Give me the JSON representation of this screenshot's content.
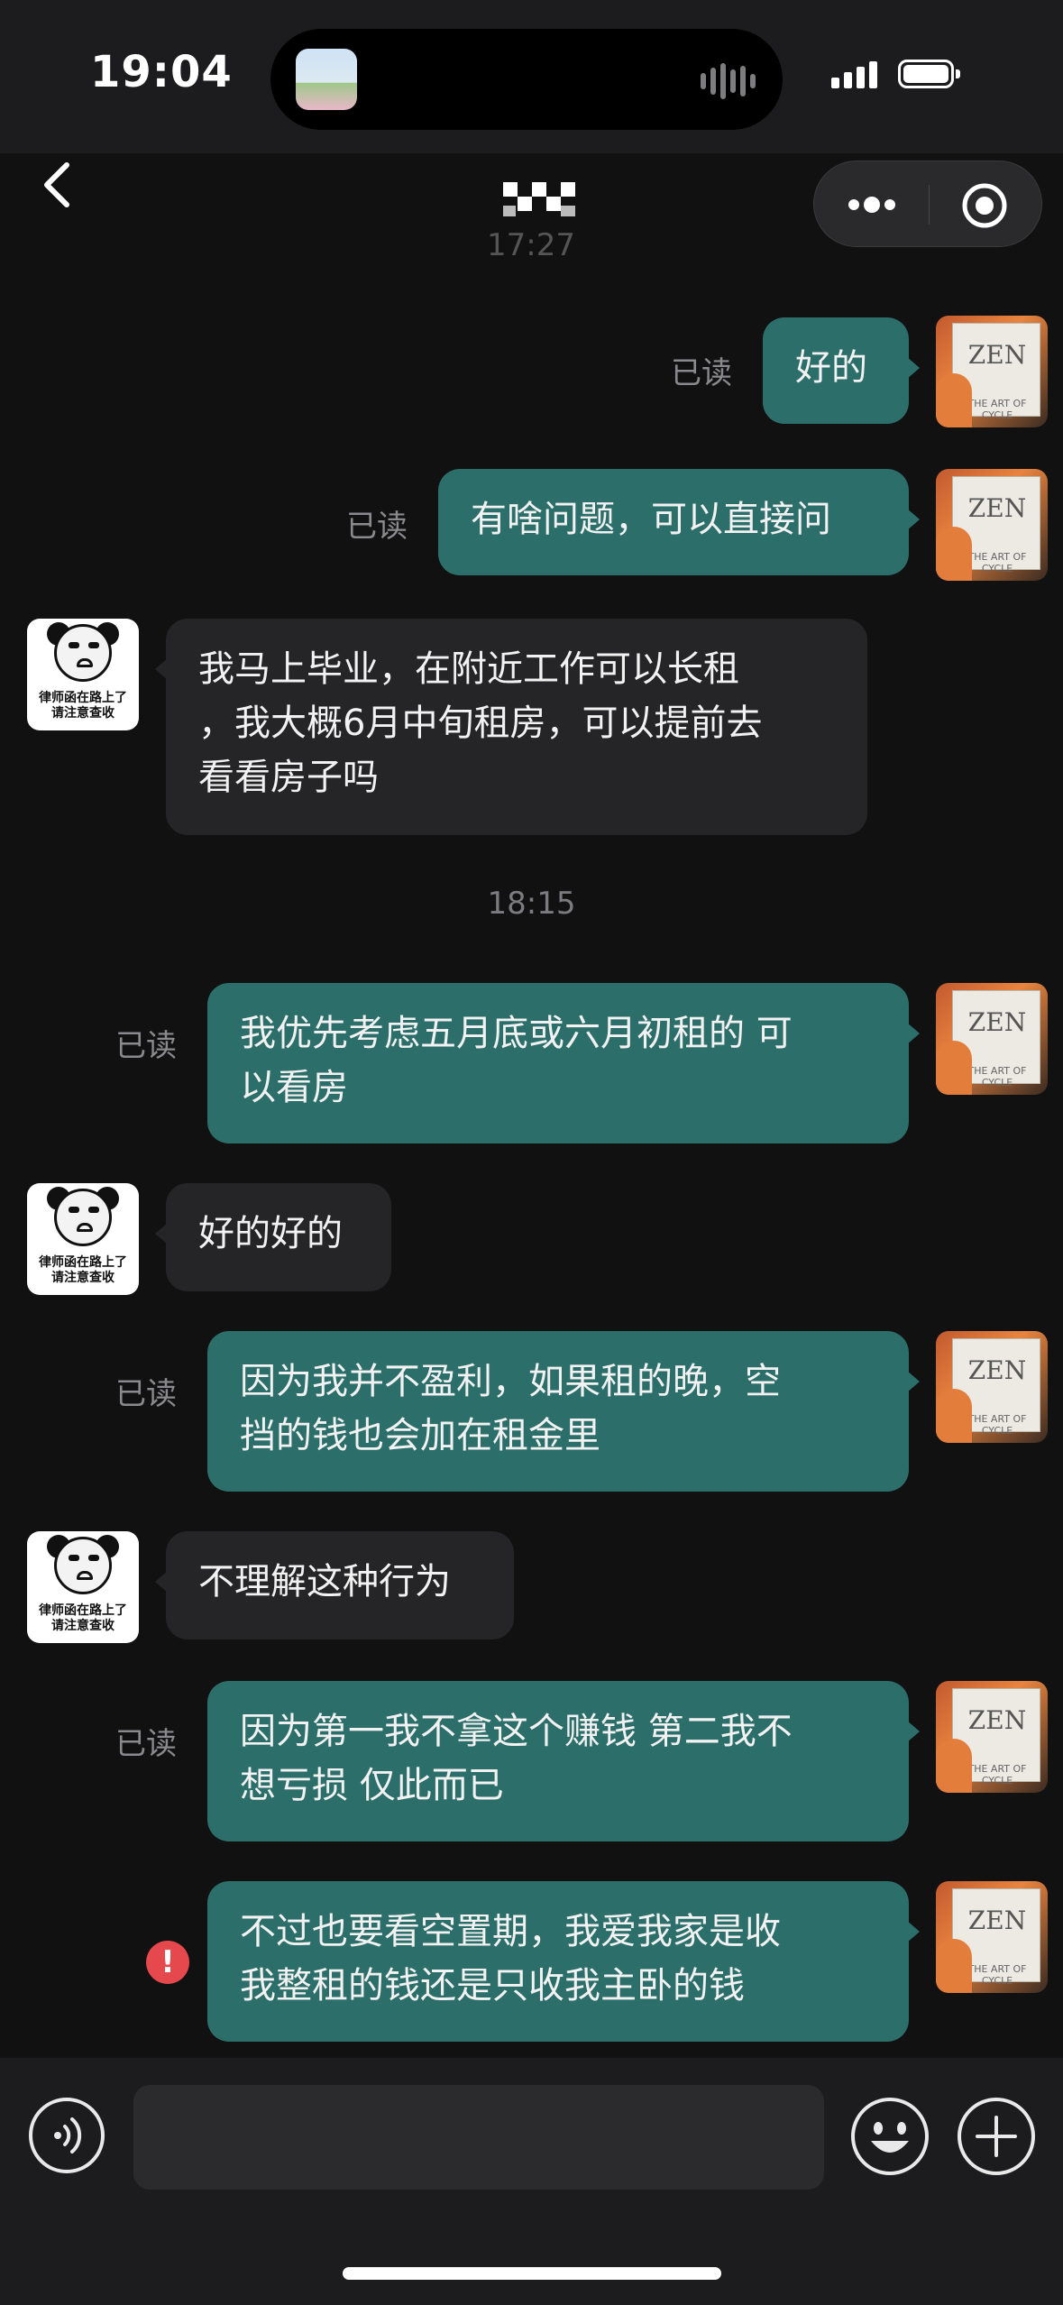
{
  "status_bar": {
    "time": "19:04"
  },
  "nav": {
    "partial_timestamp": "17:27"
  },
  "messages": [
    {
      "side": "mine",
      "text": "好的",
      "read_label": "已读"
    },
    {
      "side": "mine",
      "text": "有啥问题，可以直接问",
      "read_label": "已读"
    },
    {
      "side": "theirs",
      "lines": [
        "我马上毕业，在附近工作可以长租",
        "，我大概6月中旬租房，可以提前去",
        "看看房子吗"
      ]
    },
    {
      "side": "timestamp",
      "text": "18:15"
    },
    {
      "side": "mine",
      "lines": [
        "我优先考虑五月底或六月初租的 可",
        "以看房"
      ],
      "read_label": "已读"
    },
    {
      "side": "theirs",
      "text": "好的好的"
    },
    {
      "side": "mine",
      "lines": [
        "因为我并不盈利，如果租的晚，空",
        "挡的钱也会加在租金里"
      ],
      "read_label": "已读"
    },
    {
      "side": "theirs",
      "text": "不理解这种行为"
    },
    {
      "side": "mine",
      "lines": [
        "因为第一我不拿这个赚钱 第二我不",
        "想亏损 仅此而已"
      ],
      "read_label": "已读"
    },
    {
      "side": "mine",
      "lines": [
        "不过也要看空置期，我爱我家是收",
        "我整租的钱还是只收我主卧的钱"
      ],
      "status": "failed",
      "error_glyph": "!"
    }
  ],
  "avatars": {
    "mine": {
      "book_title": "ZEN",
      "book_subtitle": "THE ART OF CYCLE"
    },
    "theirs": {
      "caption_lines": [
        "律师函在路上了",
        "请注意查收"
      ]
    }
  },
  "input": {
    "value": ""
  },
  "colors": {
    "my_bubble": "#2c6e69",
    "their_bubble": "#252527",
    "error": "#e5484d",
    "background": "#111112"
  }
}
